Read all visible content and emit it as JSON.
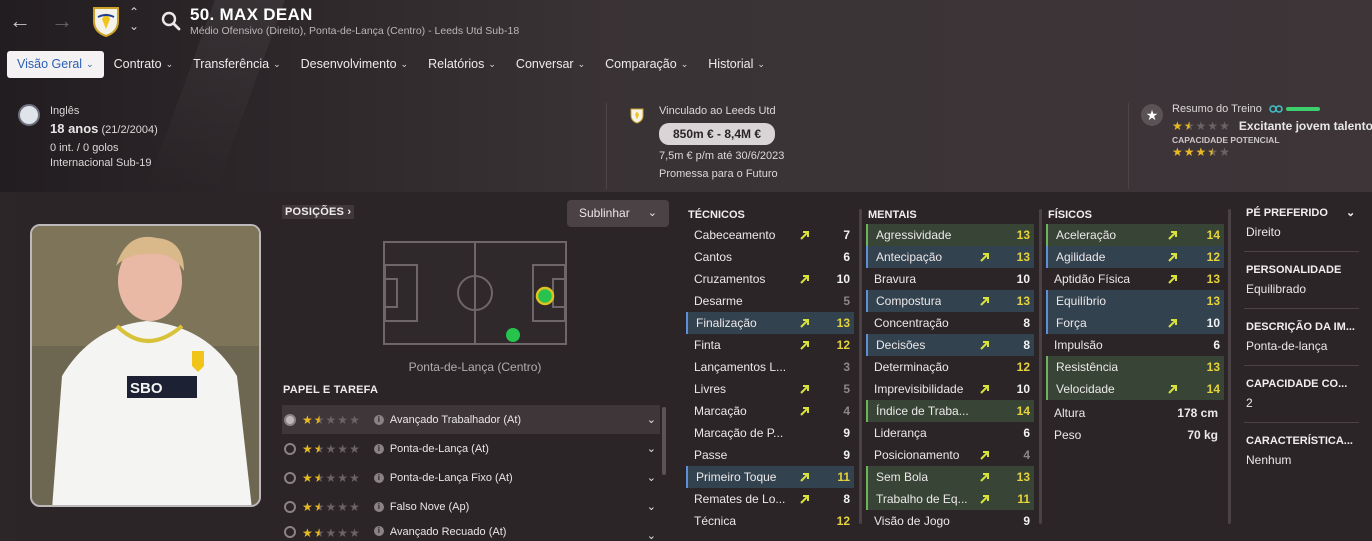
{
  "header": {
    "title": "50. MAX DEAN",
    "subtitle": "Médio Ofensivo (Direito), Ponta-de-Lança (Centro) - Leeds Utd Sub-18"
  },
  "tabs": [
    {
      "label": "Visão Geral",
      "active": true
    },
    {
      "label": "Contrato"
    },
    {
      "label": "Transferência"
    },
    {
      "label": "Desenvolvimento"
    },
    {
      "label": "Relatórios"
    },
    {
      "label": "Conversar"
    },
    {
      "label": "Comparação"
    },
    {
      "label": "Historial"
    }
  ],
  "profile": {
    "nationality": "Inglês",
    "age": "18 anos",
    "dob": "(21/2/2004)",
    "caps": "0 int. / 0 golos",
    "intl": "Internacional Sub-19"
  },
  "contract": {
    "club": "Vinculado ao Leeds Utd",
    "value": "850m € - 8,4M €",
    "wage": "7,5m € p/m até 30/6/2023",
    "status": "Promessa para o Futuro"
  },
  "training": {
    "title": "Resumo do Treino",
    "current_stars": 1.5,
    "label": "Excitante jovem talento",
    "potential_label": "CAPACIDADE POTENCIAL",
    "potential_stars": 3.5
  },
  "positions": {
    "title": "POSIÇÕES",
    "filter_label": "Sublinhar",
    "current": "Ponta-de-Lança (Centro)"
  },
  "roles": {
    "title": "PAPEL E TAREFA",
    "items": [
      {
        "name": "Avançado Trabalhador (At)",
        "stars": 1.5,
        "selected": true
      },
      {
        "name": "Ponta-de-Lança (At)",
        "stars": 1.5
      },
      {
        "name": "Ponta-de-Lança Fixo (At)",
        "stars": 1.5
      },
      {
        "name": "Falso Nove (Ap)",
        "stars": 1.5
      },
      {
        "name": "Avançado Recuado (At)",
        "stars": 1.5
      }
    ]
  },
  "technical": {
    "title": "TÉCNICOS",
    "items": [
      {
        "name": "Cabeceamento",
        "value": "7",
        "arrow": true,
        "color": "white"
      },
      {
        "name": "Cantos",
        "value": "6",
        "color": "white"
      },
      {
        "name": "Cruzamentos",
        "value": "10",
        "arrow": true,
        "color": "white"
      },
      {
        "name": "Desarme",
        "value": "5",
        "color": "gray"
      },
      {
        "name": "Finalização",
        "value": "13",
        "arrow": true,
        "color": "yellow",
        "hl": "blue"
      },
      {
        "name": "Finta",
        "value": "12",
        "arrow": true,
        "color": "yellow"
      },
      {
        "name": "Lançamentos L...",
        "value": "3",
        "color": "gray"
      },
      {
        "name": "Livres",
        "value": "5",
        "arrow": true,
        "color": "gray"
      },
      {
        "name": "Marcação",
        "value": "4",
        "arrow": true,
        "color": "gray"
      },
      {
        "name": "Marcação de P...",
        "value": "9",
        "color": "white"
      },
      {
        "name": "Passe",
        "value": "9",
        "color": "white"
      },
      {
        "name": "Primeiro Toque",
        "value": "11",
        "arrow": true,
        "color": "yellow",
        "hl": "blue"
      },
      {
        "name": "Remates de Lo...",
        "value": "8",
        "arrow": true,
        "color": "white"
      },
      {
        "name": "Técnica",
        "value": "12",
        "color": "yellow"
      }
    ]
  },
  "mental": {
    "title": "MENTAIS",
    "items": [
      {
        "name": "Agressividade",
        "value": "13",
        "color": "yellow",
        "hl": "green"
      },
      {
        "name": "Antecipação",
        "value": "13",
        "arrow": true,
        "color": "yellow",
        "hl": "blue"
      },
      {
        "name": "Bravura",
        "value": "10",
        "color": "white"
      },
      {
        "name": "Compostura",
        "value": "13",
        "arrow": true,
        "color": "yellow",
        "hl": "blue"
      },
      {
        "name": "Concentração",
        "value": "8",
        "color": "white"
      },
      {
        "name": "Decisões",
        "value": "8",
        "arrow": true,
        "color": "white",
        "hl": "blue"
      },
      {
        "name": "Determinação",
        "value": "12",
        "color": "yellow"
      },
      {
        "name": "Imprevisibilidade",
        "value": "10",
        "arrow": true,
        "color": "white"
      },
      {
        "name": "Índice de Traba...",
        "value": "14",
        "color": "yellow",
        "hl": "green"
      },
      {
        "name": "Liderança",
        "value": "6",
        "color": "white"
      },
      {
        "name": "Posicionamento",
        "value": "4",
        "arrow": true,
        "color": "gray"
      },
      {
        "name": "Sem Bola",
        "value": "13",
        "arrow": true,
        "color": "yellow",
        "hl": "green"
      },
      {
        "name": "Trabalho de Eq...",
        "value": "11",
        "arrow": true,
        "color": "yellow",
        "hl": "green"
      },
      {
        "name": "Visão de Jogo",
        "value": "9",
        "color": "white"
      }
    ]
  },
  "physical": {
    "title": "FÍSICOS",
    "items": [
      {
        "name": "Aceleração",
        "value": "14",
        "arrow": true,
        "color": "yellow",
        "hl": "green"
      },
      {
        "name": "Agilidade",
        "value": "12",
        "arrow": true,
        "color": "yellow",
        "hl": "blue"
      },
      {
        "name": "Aptidão Física",
        "value": "13",
        "arrow": true,
        "color": "yellow"
      },
      {
        "name": "Equilíbrio",
        "value": "13",
        "color": "yellow",
        "hl": "blue"
      },
      {
        "name": "Força",
        "value": "10",
        "arrow": true,
        "color": "white",
        "hl": "blue"
      },
      {
        "name": "Impulsão",
        "value": "6",
        "color": "white"
      },
      {
        "name": "Resistência",
        "value": "13",
        "color": "yellow",
        "hl": "green"
      },
      {
        "name": "Velocidade",
        "value": "14",
        "arrow": true,
        "color": "yellow",
        "hl": "green"
      }
    ],
    "height_label": "Altura",
    "height": "178 cm",
    "weight_label": "Peso",
    "weight": "70 kg"
  },
  "details": [
    {
      "title": "PÉ PREFERIDO",
      "value": "Direito"
    },
    {
      "title": "PERSONALIDADE",
      "value": "Equilibrado"
    },
    {
      "title": "DESCRIÇÃO DA IM...",
      "value": "Ponta-de-lança"
    },
    {
      "title": "CAPACIDADE CO...",
      "value": "2"
    },
    {
      "title": "CARACTERÍSTICA...",
      "value": "Nenhum"
    }
  ],
  "colors": {
    "accent": "#2b5fb5",
    "star": "#e8b923",
    "attr_yellow": "#e6d23a",
    "arrow": "#d8e23a",
    "hl_blue": "#5d8fd6",
    "hl_green": "#6db35c"
  }
}
